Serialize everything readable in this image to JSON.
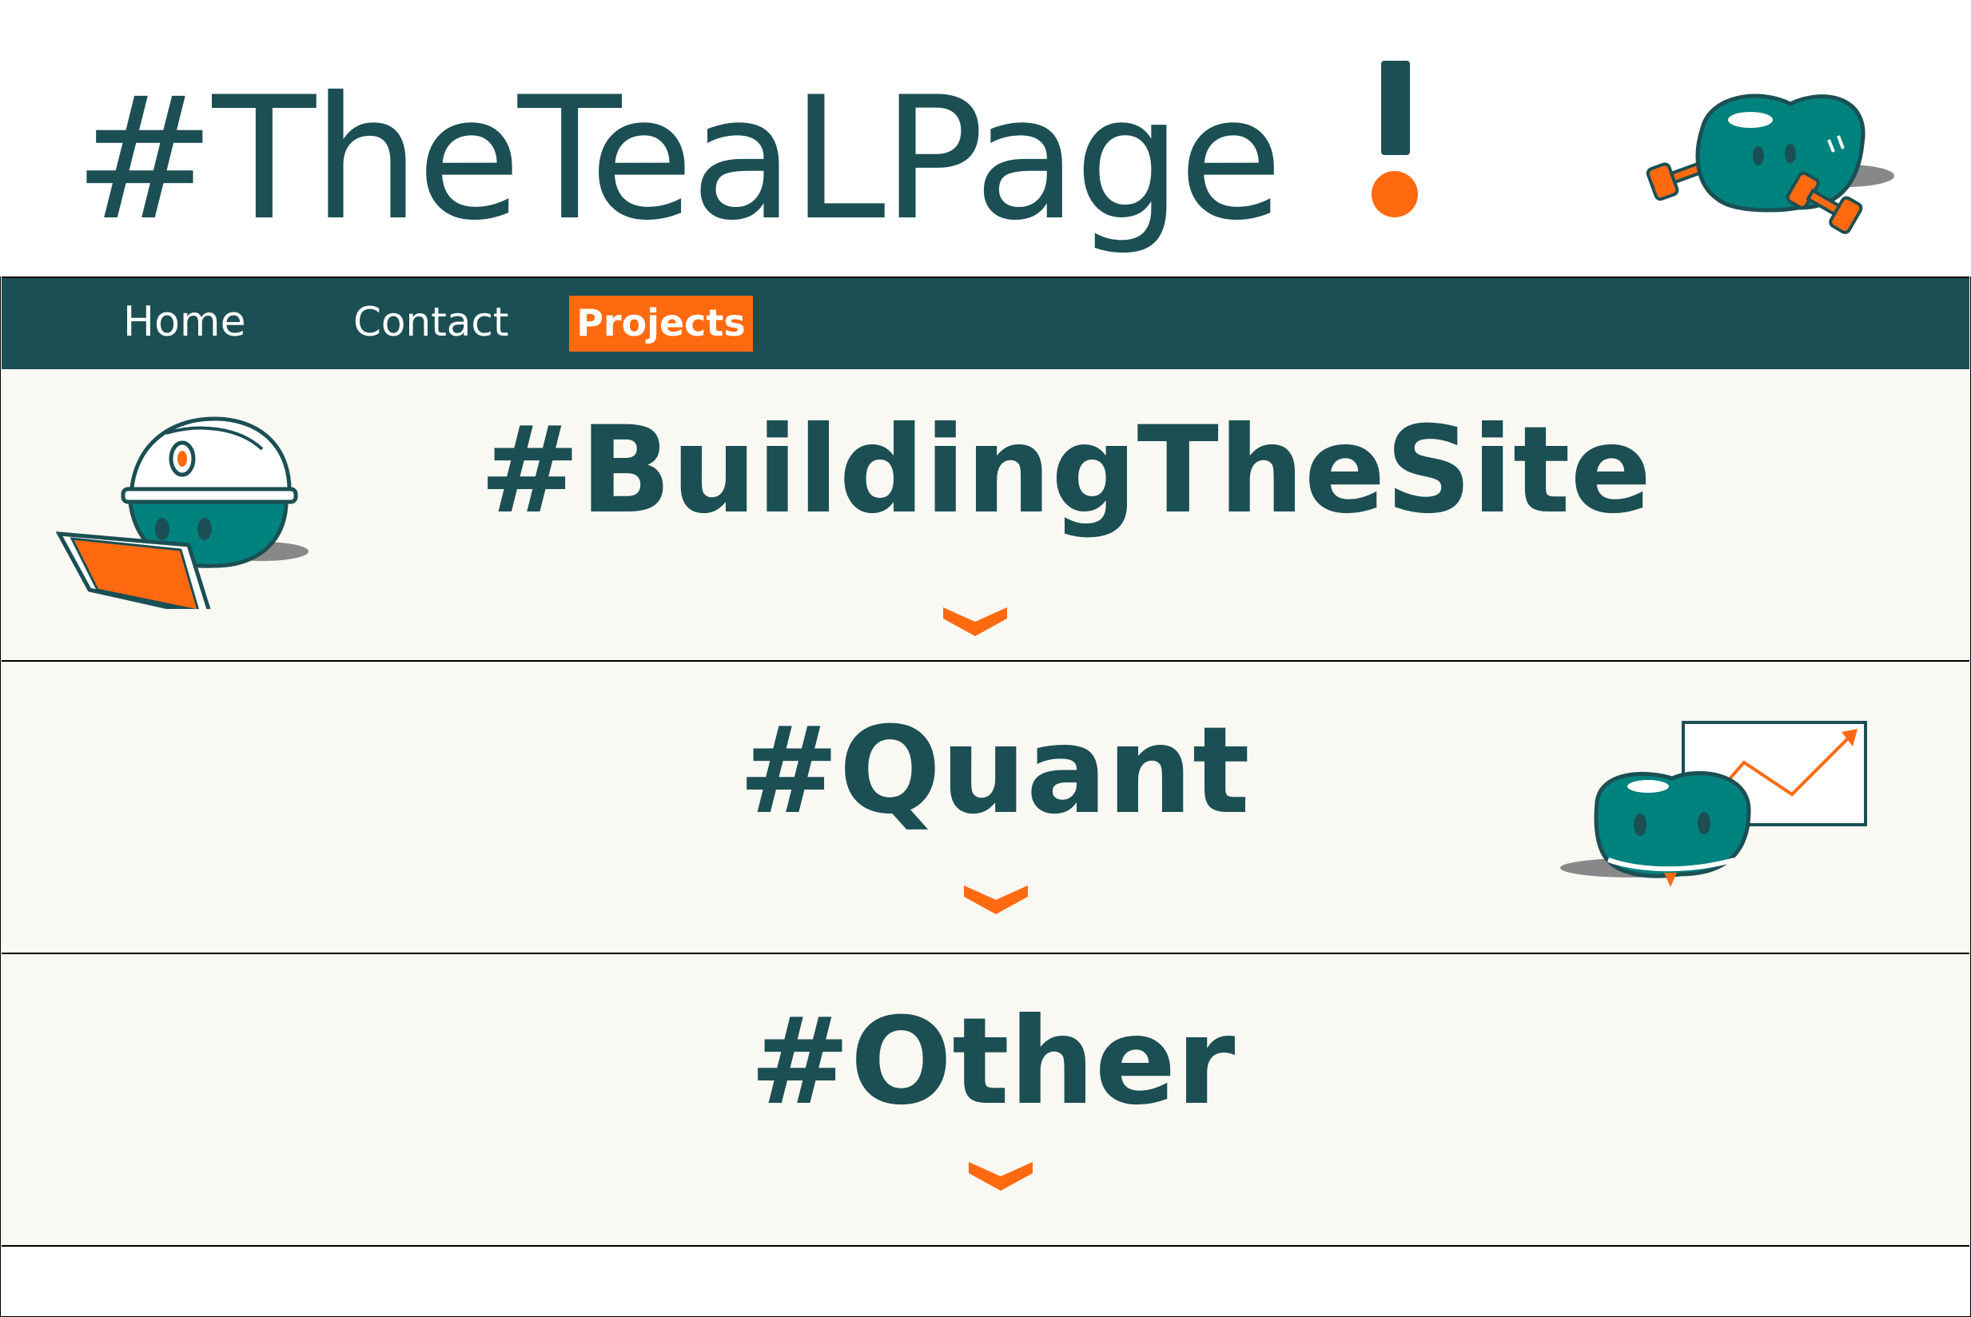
{
  "header": {
    "title": "#TheTeaLPage",
    "accent_mark": "!",
    "mascot_icon": "dumbbell-mascot-icon"
  },
  "nav": {
    "items": [
      {
        "label": "Home",
        "active": false
      },
      {
        "label": "Contact",
        "active": false
      },
      {
        "label": "Projects",
        "active": true
      }
    ]
  },
  "sections": [
    {
      "title": "#BuildingTheSite",
      "icon": "hardhat-mascot-icon",
      "expand_icon": "chevron-down-icon"
    },
    {
      "title": "#Quant",
      "icon": "chart-mascot-icon",
      "expand_icon": "chevron-down-icon"
    },
    {
      "title": "#Other",
      "expand_icon": "chevron-down-icon"
    }
  ],
  "colors": {
    "teal": "#1b4f53",
    "mascot_teal": "#00827f",
    "orange": "#ff6a10",
    "section_bg": "#f9f8f3"
  }
}
